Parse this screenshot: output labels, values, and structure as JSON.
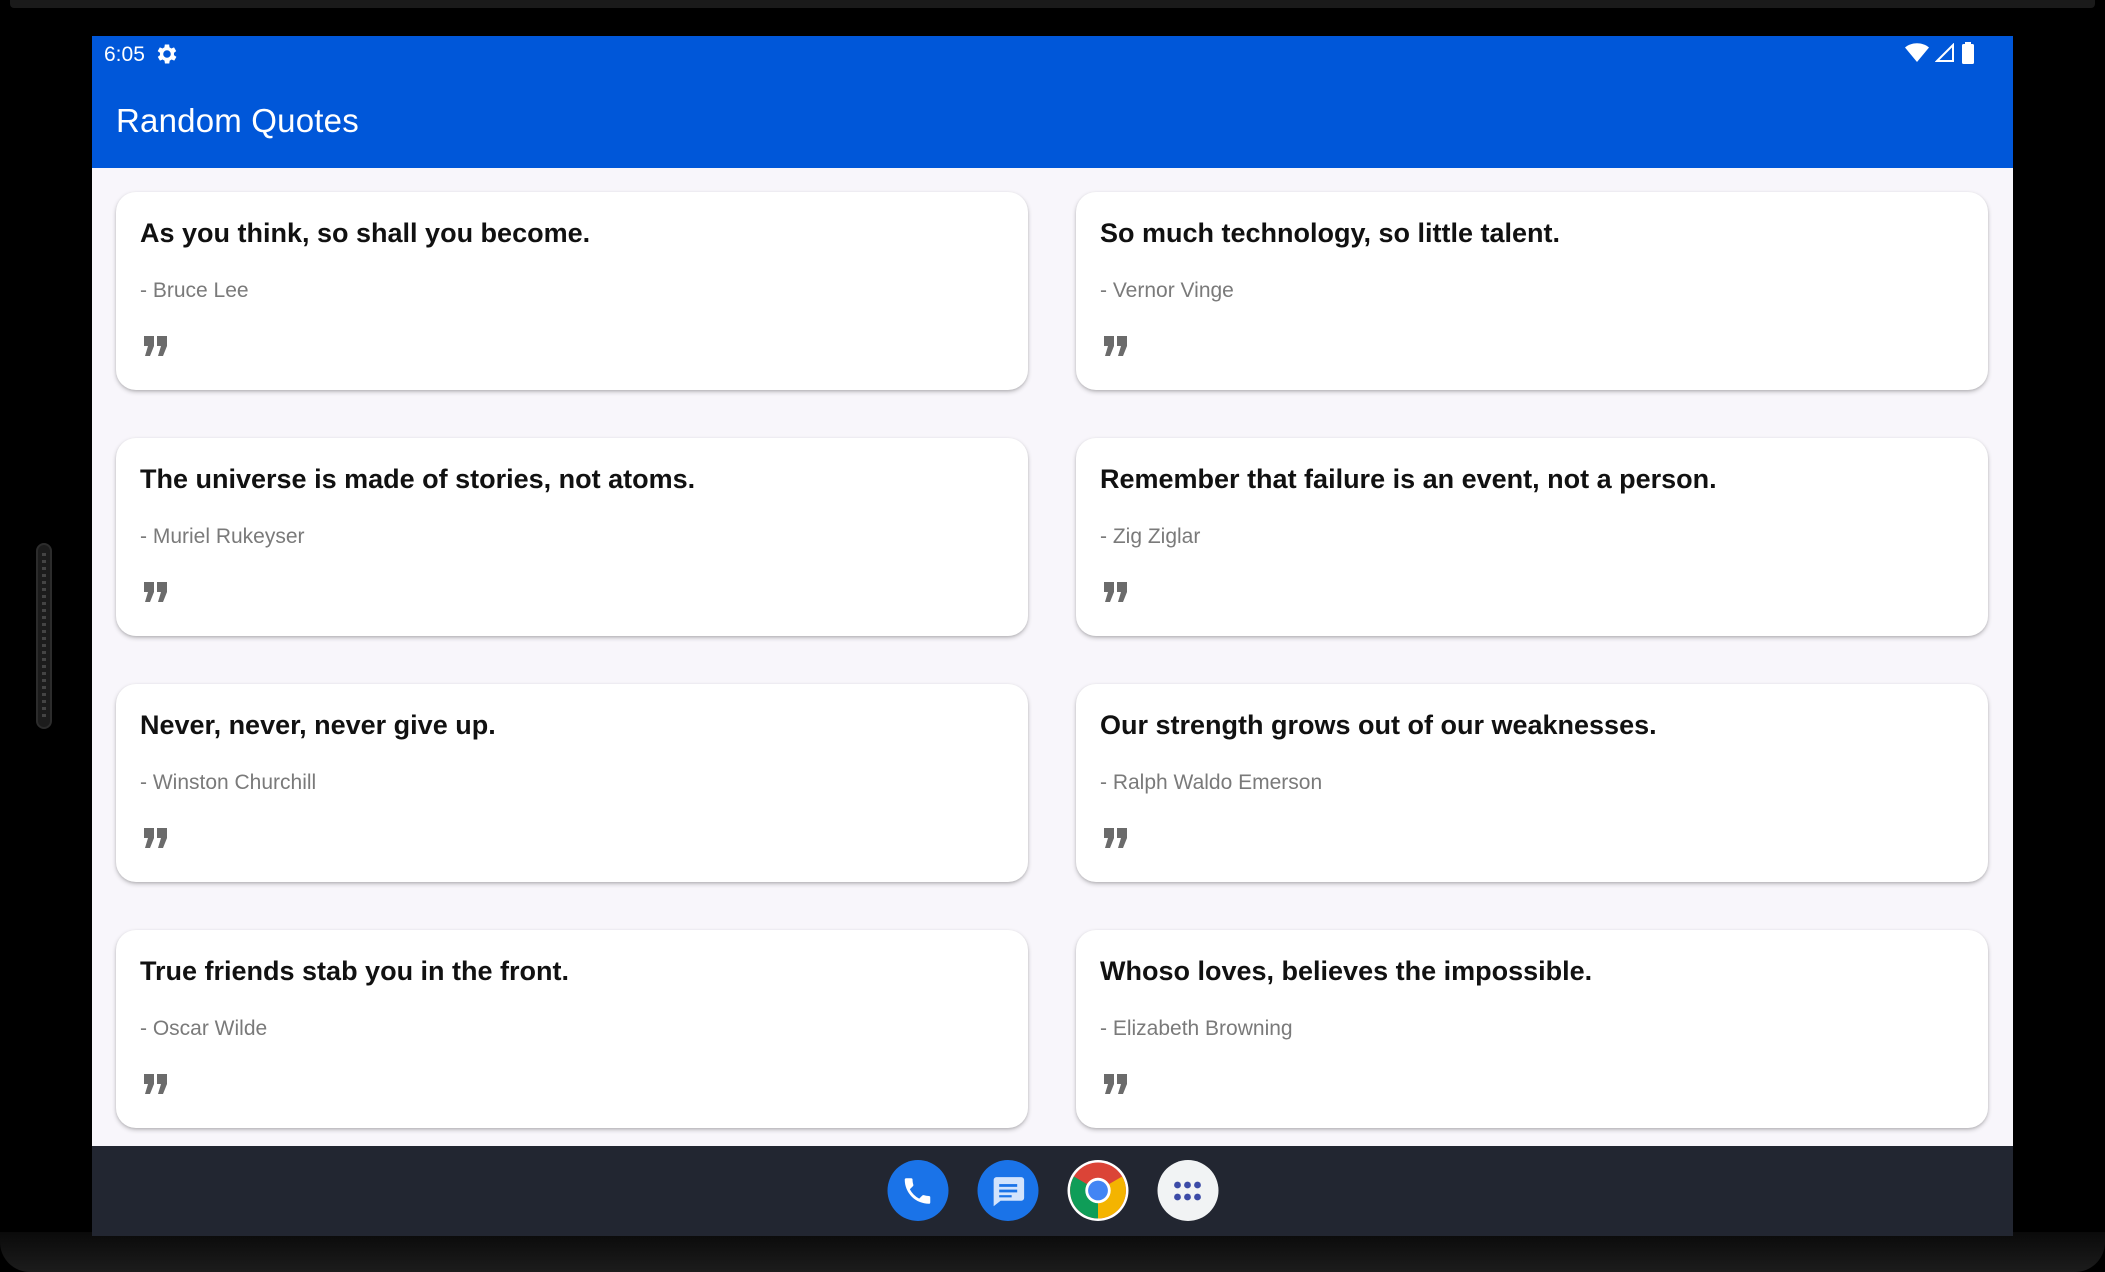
{
  "status_bar": {
    "time": "6:05",
    "left_icon": "settings-gear-icon",
    "right_icons": [
      "wifi-icon",
      "cellular-signal-icon",
      "battery-icon"
    ]
  },
  "app_bar": {
    "title": "Random Quotes",
    "color": "#0057d9"
  },
  "quotes": [
    {
      "text": "As you think, so shall you become.",
      "author": "- Bruce Lee"
    },
    {
      "text": "So much technology, so little talent.",
      "author": "- Vernor Vinge"
    },
    {
      "text": "The universe is made of stories, not atoms.",
      "author": "- Muriel Rukeyser"
    },
    {
      "text": "Remember that failure is an event, not a person.",
      "author": "- Zig Ziglar"
    },
    {
      "text": "Never, never, never give up.",
      "author": "- Winston Churchill"
    },
    {
      "text": "Our strength grows out of our weaknesses.",
      "author": "- Ralph Waldo Emerson"
    },
    {
      "text": "True friends stab you in the front.",
      "author": "- Oscar Wilde"
    },
    {
      "text": "Whoso loves, believes the impossible.",
      "author": "- Elizabeth Browning"
    }
  ],
  "dock": {
    "apps": [
      {
        "name": "phone-icon",
        "color": "#1a73e8"
      },
      {
        "name": "messages-icon",
        "color": "#1a73e8"
      },
      {
        "name": "chrome-icon",
        "color": "#ffffff"
      },
      {
        "name": "app-drawer-icon",
        "color": "#f1f3f4"
      }
    ]
  }
}
